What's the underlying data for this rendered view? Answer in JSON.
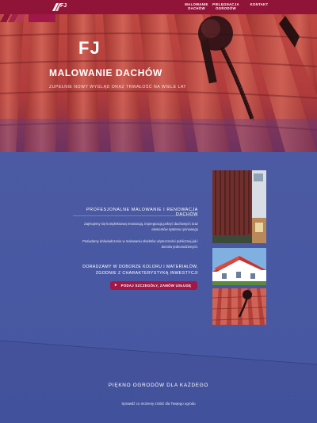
{
  "nav": {
    "items": [
      {
        "label": "MALOWANIE\nDACHÓW"
      },
      {
        "label": "PIELĘGNACJA\nOGRODÓW"
      },
      {
        "label": "KONTAKT"
      }
    ]
  },
  "brand": {
    "logo_text": "FJ"
  },
  "hero": {
    "title": "MALOWANIE DACHÓW",
    "subtitle": "ZUPEŁNIE NOWY WYGLĄD ORAZ TRWAŁOŚĆ NA WIELE LAT"
  },
  "section": {
    "title": "PROFESJONALNE MALOWANIE I RENOWACJA DACHÓW",
    "para1": "Zajmujemy się kompleksową renowacją, impregnacją pokryć dachowych oraz elementów systemu rynnowego",
    "para2": "Posiadamy doświadczenie w malowaniu obiektów użyteczności publicznej jak i domów jednorodzinnych.",
    "advice": "DORADZAMY W DOBORZE KOLORU I MATERIAŁÓW, ZGODNIE Z CHARAKTERYSTYKĄ INWESTYCJI",
    "cta_label": "PODAJ SZCZEGÓŁY, ZAMÓW USŁUGĘ"
  },
  "garden": {
    "title": "PIĘKNO OGRODÓW DLA KAŻDEGO",
    "subtitle": "Sprawdź co możemy zrobić dla Twojego ogrodu"
  },
  "colors": {
    "topbar": "#8f1438",
    "background": "#4a59a1",
    "accent": "#a11747"
  },
  "icons": [
    "logo-mark-icon",
    "arrow-right-icon"
  ]
}
